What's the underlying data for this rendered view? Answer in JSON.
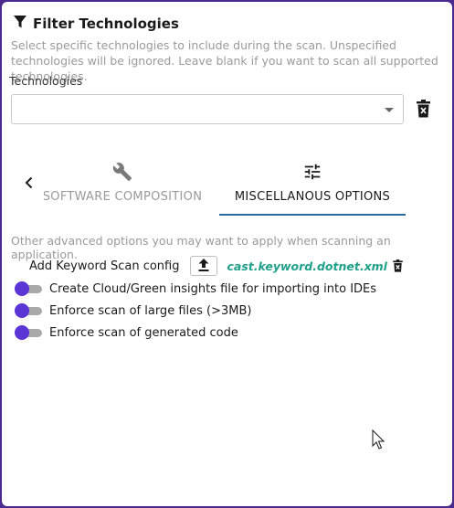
{
  "header": {
    "title": "Filter Technologies",
    "icon": "filter-icon",
    "description": "Select specific technologies to include during the scan. Unspecified technologies will be ignored. Leave blank if you want to scan all supported technologies."
  },
  "technologies": {
    "label": "Technologies",
    "selected_value": ""
  },
  "tabs": [
    {
      "label": "SOFTWARE COMPOSITION",
      "icon": "wrench-icon",
      "active": false
    },
    {
      "label": "MISCELLANOUS OPTIONS",
      "icon": "sliders-icon",
      "active": true
    }
  ],
  "misc": {
    "description": "Other advanced options you may want to apply when scanning an application.",
    "keyword_label": "Add Keyword Scan config",
    "keyword_file": "cast.keyword.dotnet.xml",
    "toggles": [
      {
        "label": "Create Cloud/Green insights file for importing into IDEs",
        "on": false
      },
      {
        "label": "Enforce scan of large files (>3MB)",
        "on": false
      },
      {
        "label": "Enforce scan of generated code",
        "on": false
      }
    ]
  },
  "colors": {
    "accent": "#5b35d6",
    "tab_indicator": "#2a6a9e",
    "file_name": "#1fa08a",
    "frame": "#4a2a8c"
  }
}
